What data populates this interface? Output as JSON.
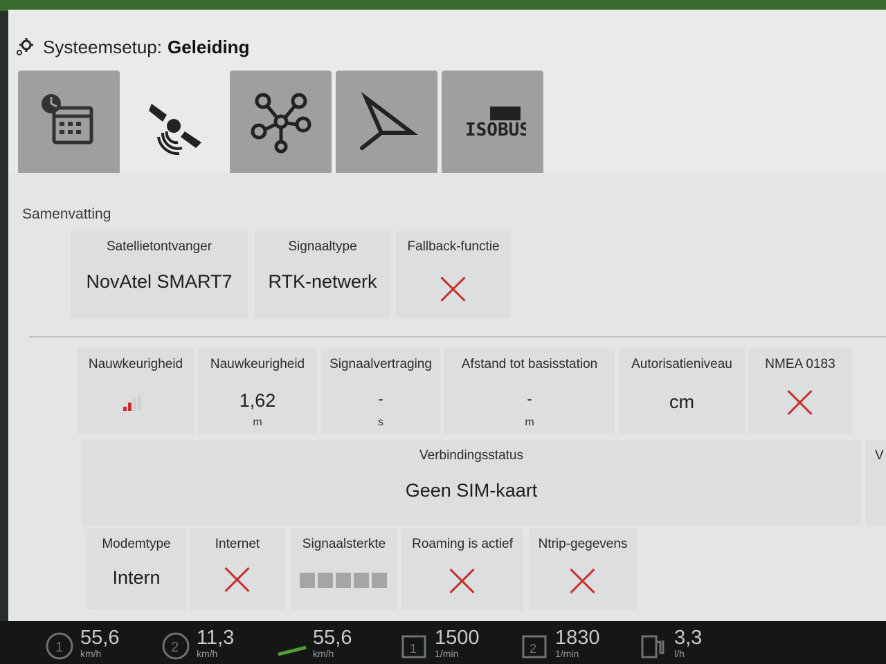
{
  "header": {
    "title_prefix": "Systeemsetup:",
    "title_main": "Geleiding"
  },
  "tabs": [
    {
      "name": "tab-calendar",
      "icon": "calendar-clock-icon"
    },
    {
      "name": "tab-guidance",
      "icon": "satellite-icon",
      "active": true
    },
    {
      "name": "tab-network",
      "icon": "network-icon"
    },
    {
      "name": "tab-implement",
      "icon": "implement-icon"
    },
    {
      "name": "tab-isobus",
      "icon": "isobus-icon",
      "label": "ISOBUS"
    }
  ],
  "summary": {
    "section_title": "Samenvatting",
    "receiver": {
      "label": "Satellietontvanger",
      "value": "NovAtel SMART7"
    },
    "signal_type": {
      "label": "Signaaltype",
      "value": "RTK-netwerk"
    },
    "fallback": {
      "label": "Fallback-functie"
    }
  },
  "metrics": {
    "accuracy_bar": {
      "label": "Nauwkeurigheid"
    },
    "accuracy": {
      "label": "Nauwkeurigheid",
      "value": "1,62",
      "unit": "m"
    },
    "signal_delay": {
      "label": "Signaalvertraging",
      "value": "-",
      "unit": "s"
    },
    "base_distance": {
      "label": "Afstand tot basisstation",
      "value": "-",
      "unit": "m"
    },
    "auth_level": {
      "label": "Autorisatieniveau",
      "value": "cm"
    },
    "nmea": {
      "label": "NMEA 0183"
    }
  },
  "connection": {
    "label": "Verbindingsstatus",
    "value": "Geen SIM-kaart",
    "edge_letter": "V"
  },
  "modem": {
    "type": {
      "label": "Modemtype",
      "value": "Intern"
    },
    "internet": {
      "label": "Internet"
    },
    "signal_strength": {
      "label": "Signaalsterkte",
      "bars": 0
    },
    "roaming": {
      "label": "Roaming is actief"
    },
    "ntrip": {
      "label": "Ntrip-gegevens"
    }
  },
  "status_bar": [
    {
      "icon": "speedometer-1-icon",
      "value": "55,6",
      "unit": "km/h"
    },
    {
      "icon": "speedometer-2-icon",
      "value": "11,3",
      "unit": "km/h"
    },
    {
      "icon": "tractor-speed-icon",
      "value": "55,6",
      "unit": "km/h"
    },
    {
      "icon": "engine-1-icon",
      "value": "1500",
      "unit": "1/min"
    },
    {
      "icon": "engine-2-icon",
      "value": "1830",
      "unit": "1/min"
    },
    {
      "icon": "fuel-icon",
      "value": "3,3",
      "unit": "l/h"
    }
  ],
  "colors": {
    "error_red": "#c9302c",
    "tab_grey": "#9e9fa1",
    "screen_bg": "#e9eaeb"
  }
}
